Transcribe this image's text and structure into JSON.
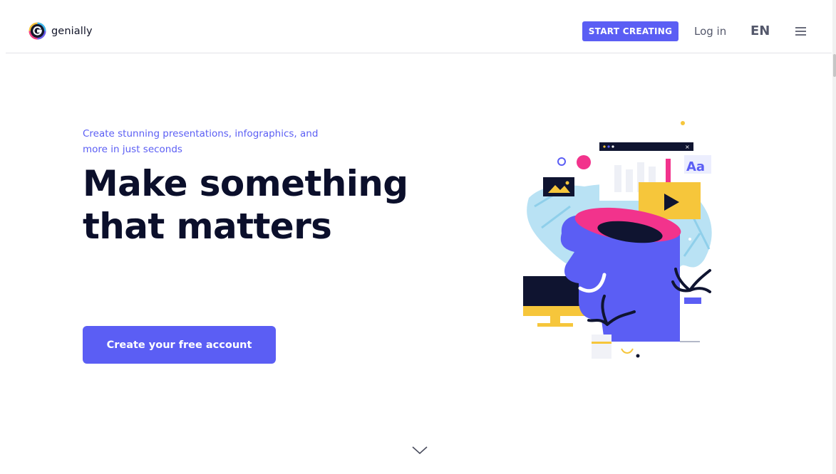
{
  "header": {
    "logo_text": "genially",
    "start_creating_label": "START CREATING",
    "login_label": "Log in",
    "language_label": "EN"
  },
  "hero": {
    "subtitle": "Create stunning presentations, infographics, and more in just seconds",
    "title": "Make something that matters",
    "cta_label": "Create your free account"
  },
  "icons": {
    "logo": "genially-logo-icon",
    "menu": "hamburger-menu-icon",
    "scroll_down": "chevron-down-icon",
    "illustration": "hero-illustration"
  },
  "colors": {
    "accent": "#5b5ef4",
    "heading": "#0b0f2b",
    "pink": "#f2338c",
    "yellow": "#f6c63b",
    "light_blue": "#a9dcf2"
  }
}
